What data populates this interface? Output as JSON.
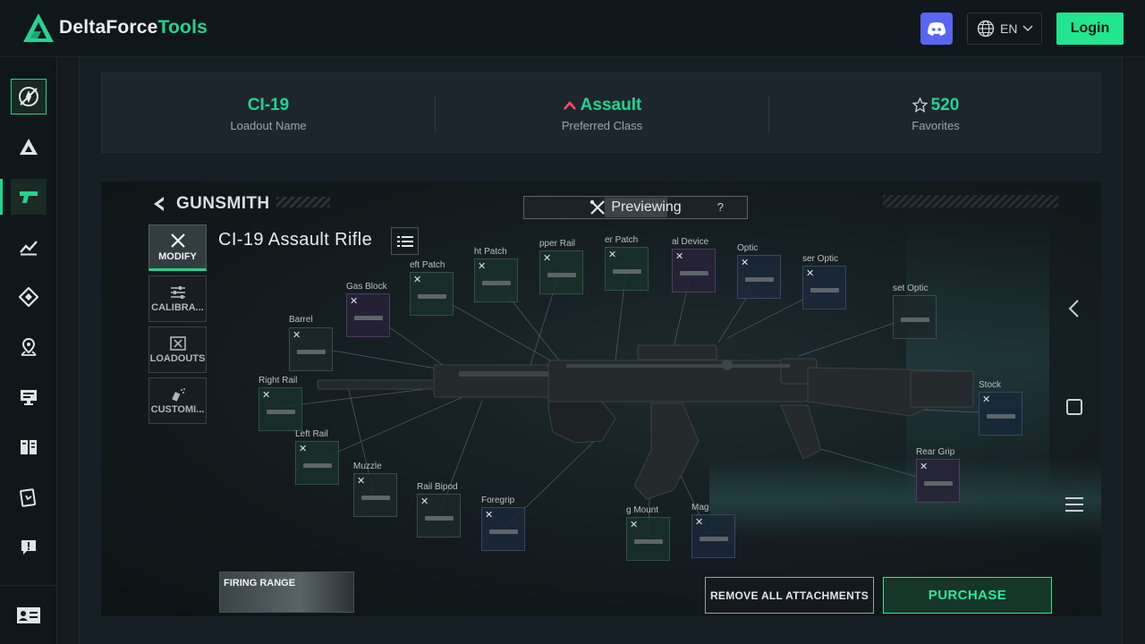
{
  "header": {
    "logo_primary": "DeltaForce",
    "logo_accent": "Tools",
    "language": "EN",
    "login_label": "Login",
    "brand_color": "#23d38f",
    "discord_color": "#5865f2"
  },
  "sidebar": {
    "items": [
      {
        "icon": "compass-icon"
      },
      {
        "icon": "delta-icon"
      },
      {
        "icon": "gun-icon"
      },
      {
        "icon": "chart-trend-icon"
      },
      {
        "icon": "diamond-nav-icon"
      },
      {
        "icon": "map-pin-icon"
      },
      {
        "icon": "monitor-icon"
      },
      {
        "icon": "book-icon"
      },
      {
        "icon": "card-icon"
      },
      {
        "icon": "alert-icon"
      }
    ],
    "footer_icon": "contact-card-icon"
  },
  "stats": {
    "loadout_name": {
      "value": "CI-19",
      "label": "Loadout Name"
    },
    "preferred_class": {
      "value": "Assault",
      "label": "Preferred Class"
    },
    "favorites": {
      "value": "520",
      "label": "Favorites"
    }
  },
  "gunsmith": {
    "title": "GUNSMITH",
    "previewing": "Previewing",
    "help": "?",
    "weapon_name": "CI-19 Assault Rifle",
    "tabs": [
      {
        "label": "MODIFY",
        "selected": true
      },
      {
        "label": "CALIBRA...",
        "selected": false
      },
      {
        "label": "LOADOUTS",
        "selected": false
      },
      {
        "label": "CUSTOMI...",
        "selected": false
      }
    ],
    "slots": [
      {
        "label": "Barrel"
      },
      {
        "label": "Gas Block"
      },
      {
        "label": "eft Patch"
      },
      {
        "label": "ht Patch"
      },
      {
        "label": "pper Rail"
      },
      {
        "label": "er Patch"
      },
      {
        "label": "al Device"
      },
      {
        "label": "Optic"
      },
      {
        "label": "ser Optic"
      },
      {
        "label": "set Optic"
      },
      {
        "label": "Right Rail"
      },
      {
        "label": "Left Rail"
      },
      {
        "label": "Muzzle"
      },
      {
        "label": "Rail Bipod"
      },
      {
        "label": "Foregrip"
      },
      {
        "label": "g Mount"
      },
      {
        "label": "Mag"
      },
      {
        "label": "Stock"
      },
      {
        "label": "Rear Grip"
      }
    ],
    "firing_range": "FIRING RANGE",
    "remove_all": "REMOVE ALL ATTACHMENTS",
    "purchase": "PURCHASE"
  }
}
